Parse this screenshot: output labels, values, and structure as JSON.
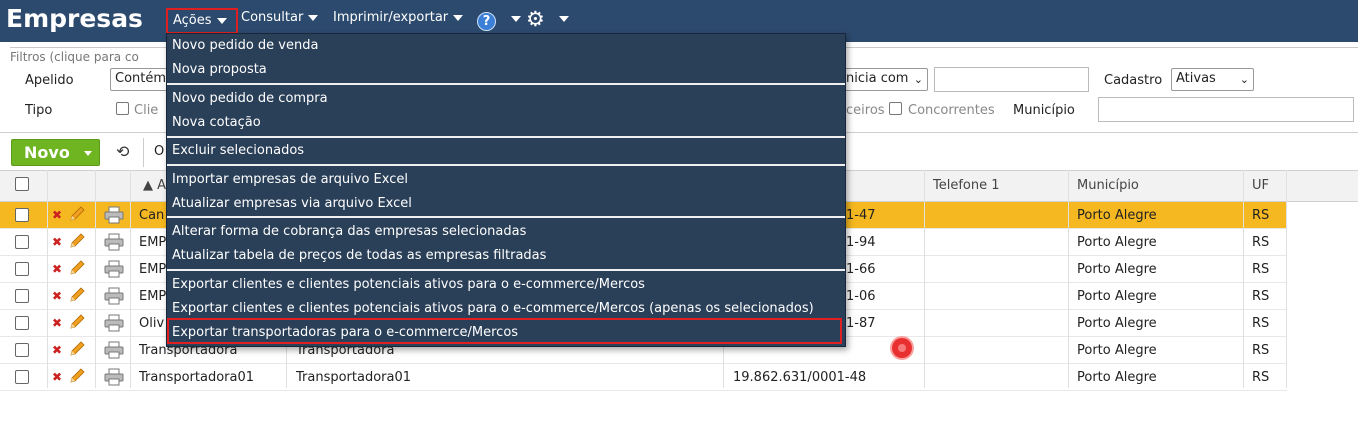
{
  "app": {
    "title": "Empresas"
  },
  "menu": {
    "acoes": "Ações",
    "consultar": "Consultar",
    "imprimir": "Imprimir/exportar",
    "help": "?"
  },
  "filters": {
    "legend": "Filtros (clique para co",
    "apelido_label": "Apelido",
    "apelido_select": "Contém",
    "inicia_select": "nicia com",
    "cadastro_label": "Cadastro",
    "cadastro_select": "Ativas",
    "tipo_label": "Tipo",
    "clientes_partial": "Clie",
    "parceiros_partial": "ceiros",
    "concorrentes": "Concorrentes",
    "municipio_label": "Município"
  },
  "toolbar": {
    "novo": "Novo",
    "partial_text": "O"
  },
  "table": {
    "headers": {
      "apelido": "A",
      "telefone": "Telefone 1",
      "municipio": "Município",
      "uf": "UF"
    },
    "rows": [
      {
        "col_a": "Can",
        "col_b": "",
        "col_c": "1-47",
        "municipio": "Porto Alegre",
        "uf": "RS",
        "selected": true
      },
      {
        "col_a": "EMP",
        "col_b": "",
        "col_c": "1-94",
        "municipio": "Porto Alegre",
        "uf": "RS"
      },
      {
        "col_a": "EMP",
        "col_b": "",
        "col_c": "1-66",
        "municipio": "Porto Alegre",
        "uf": "RS"
      },
      {
        "col_a": "EMP",
        "col_b": "",
        "col_c": "1-06",
        "municipio": "Porto Alegre",
        "uf": "RS"
      },
      {
        "col_a": "Oliv",
        "col_b": "",
        "col_c": "1-87",
        "municipio": "Porto Alegre",
        "uf": "RS"
      },
      {
        "col_a": "Transportadora",
        "col_b": "Transportadora",
        "col_c": "",
        "municipio": "Porto Alegre",
        "uf": "RS"
      },
      {
        "col_a": "Transportadora01",
        "col_b": "Transportadora01",
        "col_c": "19.862.631/0001-48",
        "municipio": "Porto Alegre",
        "uf": "RS"
      }
    ]
  },
  "dropdown": {
    "items": [
      "Novo pedido de venda",
      "Nova proposta",
      "Novo pedido de compra",
      "Nova cotação",
      "Excluir selecionados",
      "Importar empresas de arquivo Excel",
      "Atualizar empresas via arquivo Excel",
      "Alterar forma de cobrança das empresas selecionadas",
      "Atualizar tabela de preços de todas as empresas filtradas",
      "Exportar clientes e clientes potenciais ativos para o e-commerce/Mercos",
      "Exportar clientes e clientes potenciais ativos para o e-commerce/Mercos (apenas os selecionados)",
      "Exportar transportadoras para o e-commerce/Mercos"
    ]
  },
  "colors": {
    "header": "#2c4a6e",
    "dropdown": "#2a3f58",
    "selected_row": "#f5b820",
    "novo_button": "#6fb521",
    "highlight": "#e02020"
  }
}
